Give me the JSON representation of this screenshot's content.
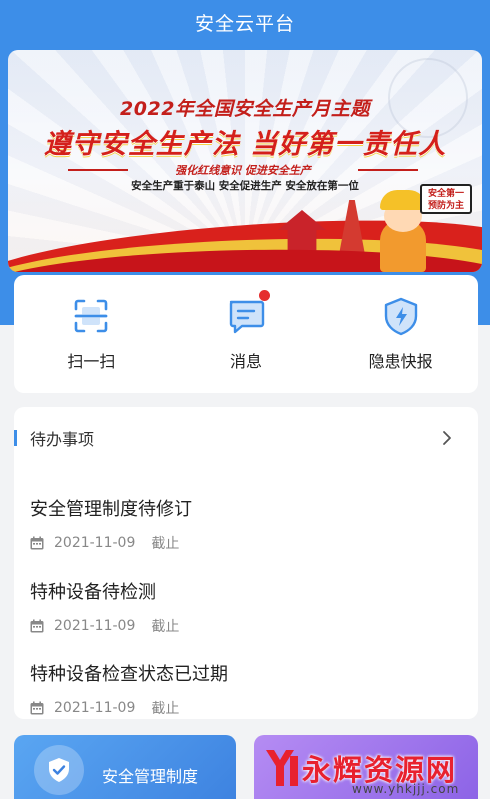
{
  "app": {
    "title": "安全云平台"
  },
  "banner": {
    "theme": "2022年全国安全生产月主题",
    "headline": "遵守安全生产法  当好第一责任人",
    "ribbon": "强化红线意识  促进安全生产",
    "slogan": "安全生产重于泰山 安全促进生产 安全放在第一位",
    "sign_line1": "安全第一",
    "sign_line2": "预防为主"
  },
  "quick_actions": [
    {
      "label": "扫一扫",
      "icon": "scan-icon"
    },
    {
      "label": "消息",
      "icon": "message-icon",
      "has_badge": true
    },
    {
      "label": "隐患快报",
      "icon": "hazard-report-icon"
    }
  ],
  "todo": {
    "title": "待办事项",
    "items": [
      {
        "title": "安全管理制度待修订",
        "date": "2021-11-09",
        "status": "截止"
      },
      {
        "title": "特种设备待检测",
        "date": "2021-11-09",
        "status": "截止"
      },
      {
        "title": "特种设备检查状态已过期",
        "date": "2021-11-09",
        "status": "截止"
      }
    ]
  },
  "bottom_cards": {
    "left_label": "安全管理制度"
  },
  "watermark": {
    "text": "永辉资源网",
    "url": "www.yhkjjj.com"
  },
  "colors": {
    "primary": "#3d8ee8",
    "badge": "#e52d2d",
    "accent_red": "#d4201b"
  }
}
